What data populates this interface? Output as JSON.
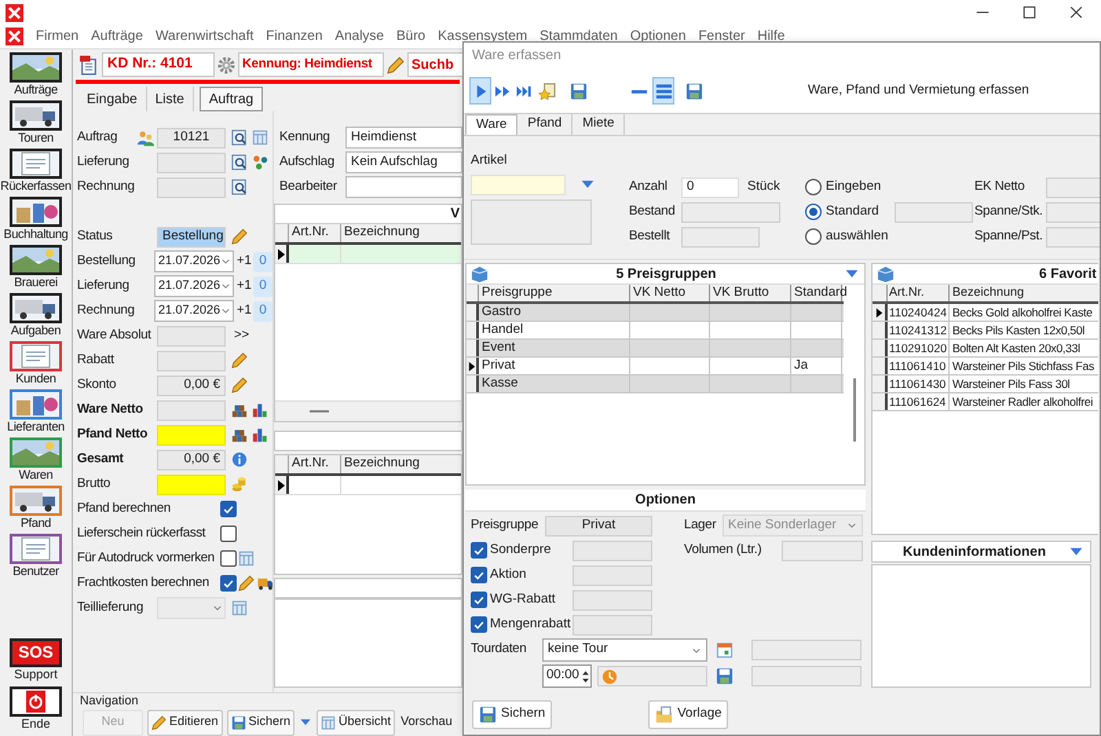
{
  "menu": [
    "Firmen",
    "Aufträge",
    "Warenwirtschaft",
    "Finanzen",
    "Analyse",
    "Büro",
    "Kassensystem",
    "Stammdaten",
    "Optionen",
    "Fenster",
    "Hilfe"
  ],
  "sidebar": {
    "items": [
      {
        "label": "Aufträge",
        "color": "#202020"
      },
      {
        "label": "Touren",
        "color": "#202020"
      },
      {
        "label": "Rückerfassen",
        "color": "#202020"
      },
      {
        "label": "Buchhaltung",
        "color": "#202020"
      },
      {
        "label": "Brauerei",
        "color": "#202020"
      },
      {
        "label": "Aufgaben",
        "color": "#202020"
      },
      {
        "label": "Kunden",
        "color": "#d9363e"
      },
      {
        "label": "Lieferanten",
        "color": "#3b82d6"
      },
      {
        "label": "Waren",
        "color": "#2e9e48"
      },
      {
        "label": "Pfand",
        "color": "#e07b2a"
      },
      {
        "label": "Benutzer",
        "color": "#8e4fa8"
      }
    ],
    "support": {
      "badge": "SOS",
      "label": "Support"
    },
    "exit": {
      "label": "Ende"
    }
  },
  "header": {
    "customer": "KD Nr.: 4101",
    "kennung": "Kennung: Heimdienst",
    "search": "Suchb"
  },
  "tabs": [
    {
      "label": "Eingabe",
      "selected": false
    },
    {
      "label": "Liste",
      "selected": false
    },
    {
      "label": "Auftrag",
      "selected": true
    }
  ],
  "order_numbers": [
    {
      "label": "Auftrag",
      "value": "10121"
    },
    {
      "label": "Lieferung"
    },
    {
      "label": "Rechnung"
    }
  ],
  "status": {
    "label": "Status",
    "value": "Bestellung"
  },
  "dates": [
    {
      "label": "Bestellung",
      "value": "21.07.2026",
      "step": "+1",
      "count": "0"
    },
    {
      "label": "Lieferung",
      "value": "21.07.2026",
      "step": "+1",
      "count": "0"
    },
    {
      "label": "Rechnung",
      "value": "21.07.2026",
      "step": "+1",
      "count": "0"
    }
  ],
  "amounts": [
    {
      "label": "Ware Absolut",
      "emphasized": false,
      "highlighted": false,
      "suffix": ">>"
    },
    {
      "label": "Rabatt",
      "emphasized": false,
      "highlighted": false
    },
    {
      "label": "Skonto",
      "value": "0,00 €",
      "emphasized": false,
      "highlighted": false
    },
    {
      "label": "Ware Netto",
      "emphasized": true,
      "highlighted": false
    },
    {
      "label": "Pfand Netto",
      "emphasized": true,
      "highlighted": true
    },
    {
      "label": "Gesamt",
      "value": "0,00 €",
      "emphasized": true,
      "highlighted": false
    },
    {
      "label": "Brutto",
      "emphasized": false,
      "highlighted": true
    }
  ],
  "checks": [
    {
      "label": "Pfand berechnen",
      "checked": true
    },
    {
      "label": "Lieferschein rückerfasst",
      "checked": false
    },
    {
      "label": "Für Autodruck vormerken",
      "checked": false
    },
    {
      "label": "Frachtkosten berechnen",
      "checked": true
    }
  ],
  "partial_delivery": {
    "label": "Teillieferung"
  },
  "details": [
    {
      "label": "Kennung",
      "value": "Heimdienst"
    },
    {
      "label": "Aufschlag",
      "value": "Kein Aufschlag"
    },
    {
      "label": "Bearbeiter"
    }
  ],
  "grid_top": {
    "header": "V",
    "columns": [
      "Art.Nr.",
      "Bezeichnung"
    ]
  },
  "grid_bottom": {
    "columns": [
      "Art.Nr.",
      "Bezeichnung"
    ]
  },
  "navigation": {
    "title": "Navigation",
    "buttons": [
      {
        "label": "Neu",
        "disabled": true
      },
      {
        "label": "Editieren",
        "disabled": false
      },
      {
        "label": "Sichern",
        "disabled": false
      },
      {
        "label": "Übersicht",
        "disabled": false
      }
    ],
    "preview": "Vorschau"
  },
  "dialog": {
    "title": "Ware erfassen",
    "caption": "Ware, Pfand und Vermietung erfassen",
    "toolbar": [
      {
        "kind": "play",
        "selected": true
      },
      {
        "kind": "fast-forward",
        "selected": false
      },
      {
        "kind": "skip",
        "selected": false
      },
      {
        "kind": "favorite",
        "selected": false
      },
      {
        "kind": "save",
        "selected": false
      },
      {
        "kind": "collapse",
        "selected": false
      },
      {
        "kind": "list",
        "selected": true
      },
      {
        "kind": "save",
        "selected": false
      }
    ],
    "tabs": [
      {
        "label": "Ware",
        "selected": true
      },
      {
        "label": "Pfand",
        "selected": false
      },
      {
        "label": "Miete",
        "selected": false
      }
    ],
    "article": {
      "label": "Artikel"
    },
    "quantity": {
      "label": "Anzahl",
      "value": "0",
      "unit": "Stück"
    },
    "stock": [
      {
        "label": "Bestand"
      },
      {
        "label": "Bestellt"
      }
    ],
    "price_mode": [
      {
        "label": "Eingeben",
        "selected": false
      },
      {
        "label": "Standard",
        "selected": true
      },
      {
        "label": "auswählen",
        "selected": false
      }
    ],
    "margins": [
      {
        "label": "EK Netto"
      },
      {
        "label": "Spanne/Stk."
      },
      {
        "label": "Spanne/Pst."
      }
    ],
    "price_groups": {
      "title": "5 Preisgruppen",
      "columns": [
        "Preisgruppe",
        "VK Netto",
        "VK Brutto",
        "Standard"
      ],
      "rows": [
        {
          "name": "Gastro",
          "selected": false
        },
        {
          "name": "Handel",
          "selected": false
        },
        {
          "name": "Event",
          "selected": false
        },
        {
          "name": "Privat",
          "standard": "Ja",
          "selected": true
        },
        {
          "name": "Kasse",
          "selected": false
        }
      ]
    },
    "favorites": {
      "title": "6 Favorit",
      "columns": [
        "Art.Nr.",
        "Bezeichnung"
      ],
      "rows": [
        {
          "number": "110240424",
          "name": "Becks Gold alkoholfrei Kaste",
          "selected": true
        },
        {
          "number": "110241312",
          "name": "Becks Pils Kasten 12x0,50l",
          "selected": false
        },
        {
          "number": "110291020",
          "name": "Bolten Alt Kasten 20x0,33l",
          "selected": false
        },
        {
          "number": "111061410",
          "name": "Warsteiner Pils Stichfass Fas",
          "selected": false
        },
        {
          "number": "111061430",
          "name": "Warsteiner Pils Fass 30l",
          "selected": false
        },
        {
          "number": "111061624",
          "name": "Warsteiner Radler alkoholfrei",
          "selected": false
        }
      ]
    },
    "options": {
      "title": "Optionen",
      "price_group": {
        "label": "Preisgruppe",
        "value": "Privat"
      },
      "storage": {
        "label": "Lager",
        "value": "Keine Sonderlager",
        "disabled": true
      },
      "volume": {
        "label": "Volumen (Ltr.)"
      },
      "discounts": [
        {
          "label": "Sonderpre",
          "checked": true
        },
        {
          "label": "Aktion",
          "checked": true
        },
        {
          "label": "WG-Rabatt",
          "checked": true
        },
        {
          "label": "Mengenrabatt",
          "checked": true
        }
      ],
      "tour": {
        "label": "Tourdaten",
        "value": "keine Tour",
        "time": "00:00"
      }
    },
    "customer_info": {
      "title": "Kundeninformationen"
    },
    "buttons": [
      "Sichern",
      "Vorlage"
    ]
  }
}
